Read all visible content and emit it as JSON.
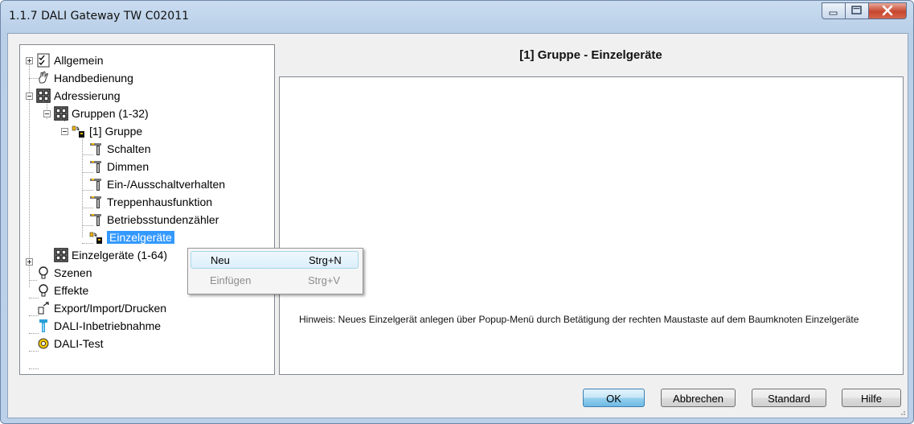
{
  "window": {
    "title": "1.1.7 DALI Gateway TW C02011",
    "controls": [
      "minimize-icon",
      "maximize-icon",
      "close-icon"
    ]
  },
  "tree": {
    "items": [
      {
        "label": "Allgemein",
        "icon": "checklist-icon"
      },
      {
        "label": "Handbedienung",
        "icon": "hand-icon"
      },
      {
        "label": "Adressierung",
        "icon": "grid-icon"
      },
      {
        "label": "Gruppen (1-32)",
        "icon": "grid-icon"
      },
      {
        "label": "[1] Gruppe",
        "icon": "group-device-icon"
      },
      {
        "label": "Schalten",
        "icon": "lamp-icon"
      },
      {
        "label": "Dimmen",
        "icon": "lamp-icon"
      },
      {
        "label": "Ein-/Ausschaltverhalten",
        "icon": "lamp-icon"
      },
      {
        "label": "Treppenhausfunktion",
        "icon": "lamp-icon"
      },
      {
        "label": "Betriebsstundenzähler",
        "icon": "lamp-icon"
      },
      {
        "label": "Einzelgeräte",
        "icon": "group-device-icon",
        "selected": true
      },
      {
        "label": "Einzelgeräte (1-64)",
        "icon": "grid-icon"
      },
      {
        "label": "Szenen",
        "icon": "bulb-icon"
      },
      {
        "label": "Effekte",
        "icon": "bulb-icon"
      },
      {
        "label": "Export/Import/Drucken",
        "icon": "export-icon"
      },
      {
        "label": "DALI-Inbetriebnahme",
        "icon": "commissioning-icon"
      },
      {
        "label": "DALI-Test",
        "icon": "test-icon"
      }
    ]
  },
  "panel": {
    "title": "[1] Gruppe - Einzelgeräte",
    "hint": "Hinweis: Neues Einzelgerät anlegen über Popup-Menü durch Betätigung der rechten  Maustaste auf dem Baumknoten Einzelgeräte"
  },
  "context_menu": {
    "items": [
      {
        "label": "Neu",
        "shortcut": "Strg+N",
        "enabled": true
      },
      {
        "label": "Einfügen",
        "shortcut": "Strg+V",
        "enabled": false
      }
    ]
  },
  "buttons": {
    "ok": "OK",
    "cancel": "Abbrechen",
    "default": "Standard",
    "help": "Hilfe"
  },
  "colors": {
    "selection": "#3399ff",
    "window_frame": "#bcd1e9",
    "dialog_bg": "#f0f0f0"
  }
}
